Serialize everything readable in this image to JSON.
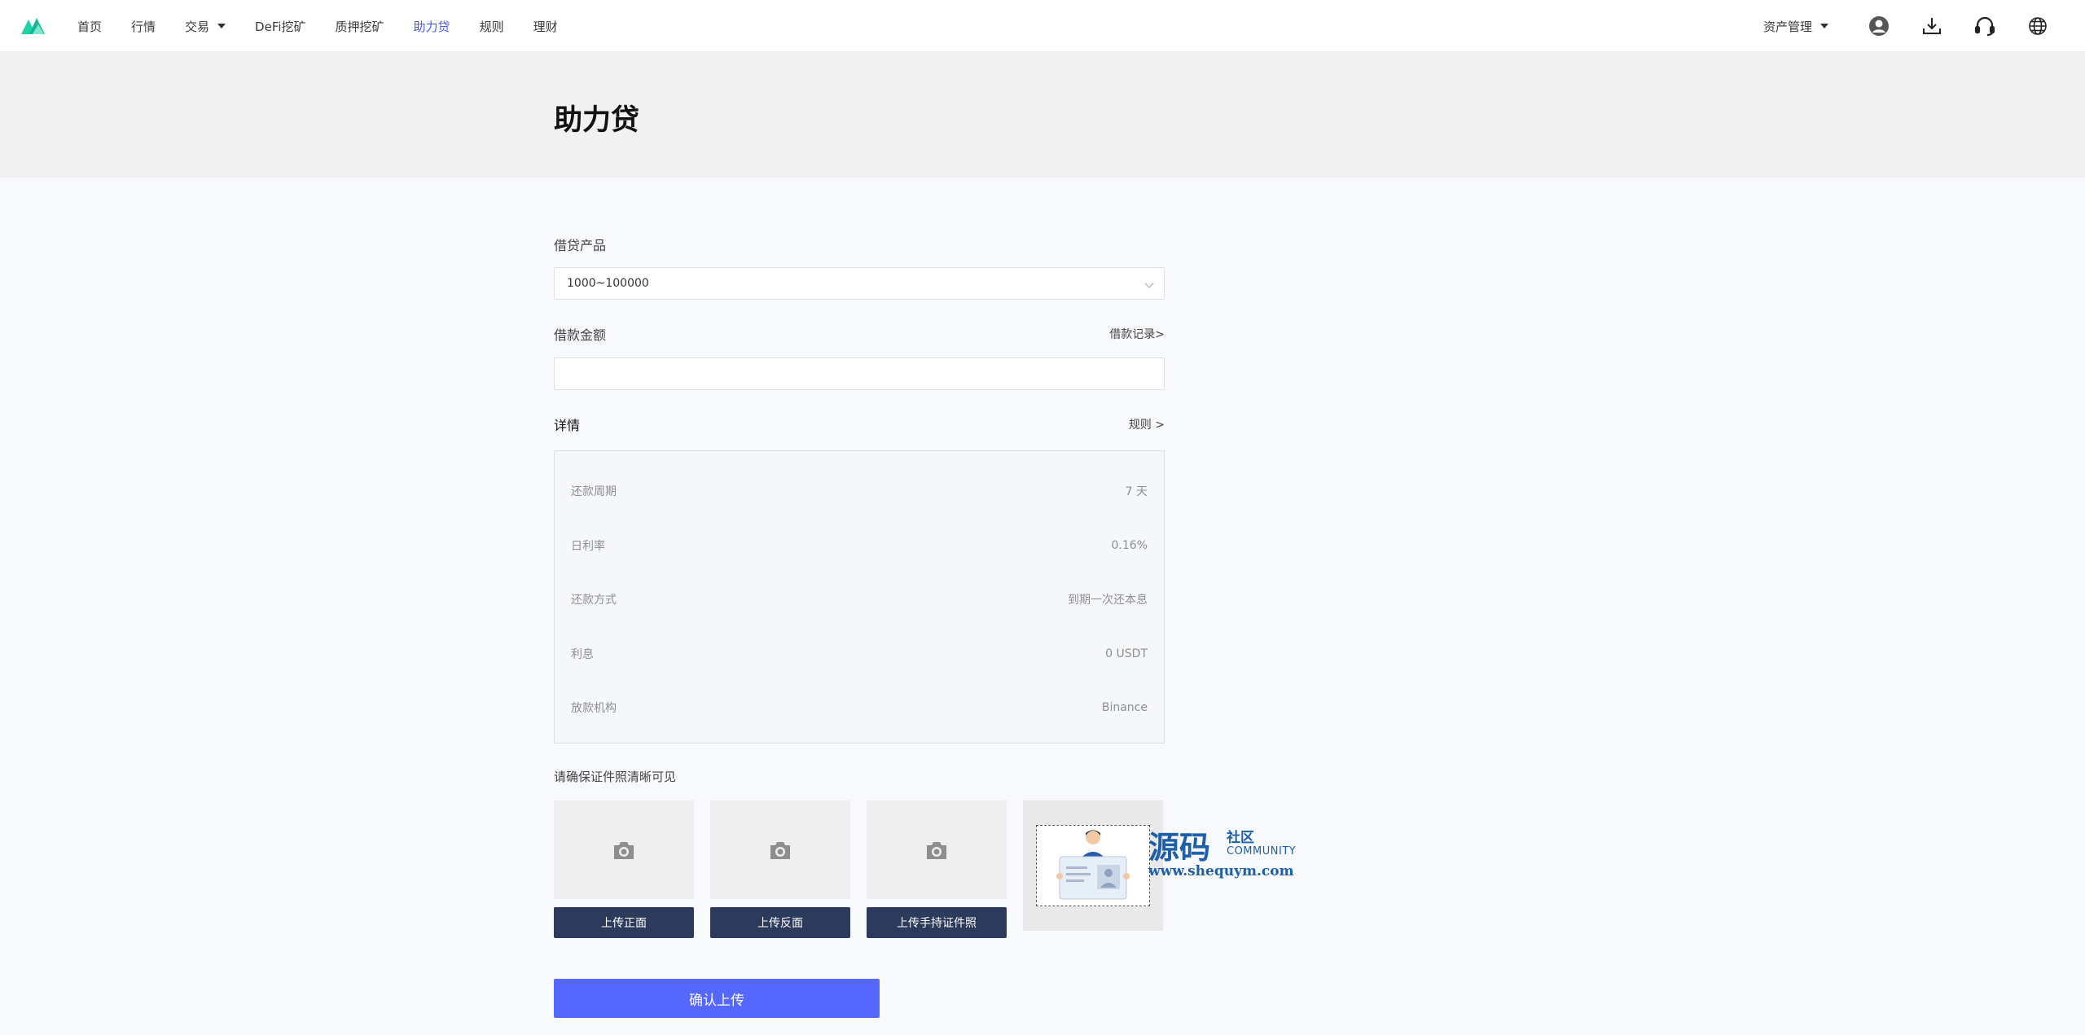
{
  "nav": {
    "items": [
      {
        "label": "首页"
      },
      {
        "label": "行情"
      },
      {
        "label": "交易"
      },
      {
        "label": "DeFi挖矿"
      },
      {
        "label": "质押挖矿"
      },
      {
        "label": "助力贷"
      },
      {
        "label": "规则"
      },
      {
        "label": "理财"
      }
    ],
    "active": "助力贷",
    "asset_menu": "资产管理",
    "icons": [
      "user-icon",
      "download-icon",
      "headset-icon",
      "globe-icon"
    ]
  },
  "page": {
    "title": "助力贷"
  },
  "form": {
    "product_label": "借贷产品",
    "product_value": "1000~100000",
    "amount_label": "借款金额",
    "amount_value": "",
    "records_link": "借款记录>",
    "details_label": "详情",
    "rules_link": "规则 >",
    "details": [
      {
        "label": "还款周期",
        "value": "7 天"
      },
      {
        "label": "日利率",
        "value": "0.16%"
      },
      {
        "label": "还款方式",
        "value": "到期一次还本息"
      },
      {
        "label": "利息",
        "value": "0 USDT"
      },
      {
        "label": "放款机构",
        "value": "Binance"
      }
    ],
    "upload_hint": "请确保证件照清晰可见",
    "uploads": [
      {
        "button": "上传正面"
      },
      {
        "button": "上传反面"
      },
      {
        "button": "上传手持证件照"
      }
    ],
    "confirm_button": "确认上传"
  },
  "watermark": {
    "main": "源码",
    "side1": "社区",
    "side2": "COMMUNITY",
    "url": "www.shequym.com"
  },
  "colors": {
    "accent": "#5468ff",
    "nav_active": "#4a5ae8",
    "upload_button": "#2c3a5c",
    "logo_green": "#1fc7a0"
  }
}
